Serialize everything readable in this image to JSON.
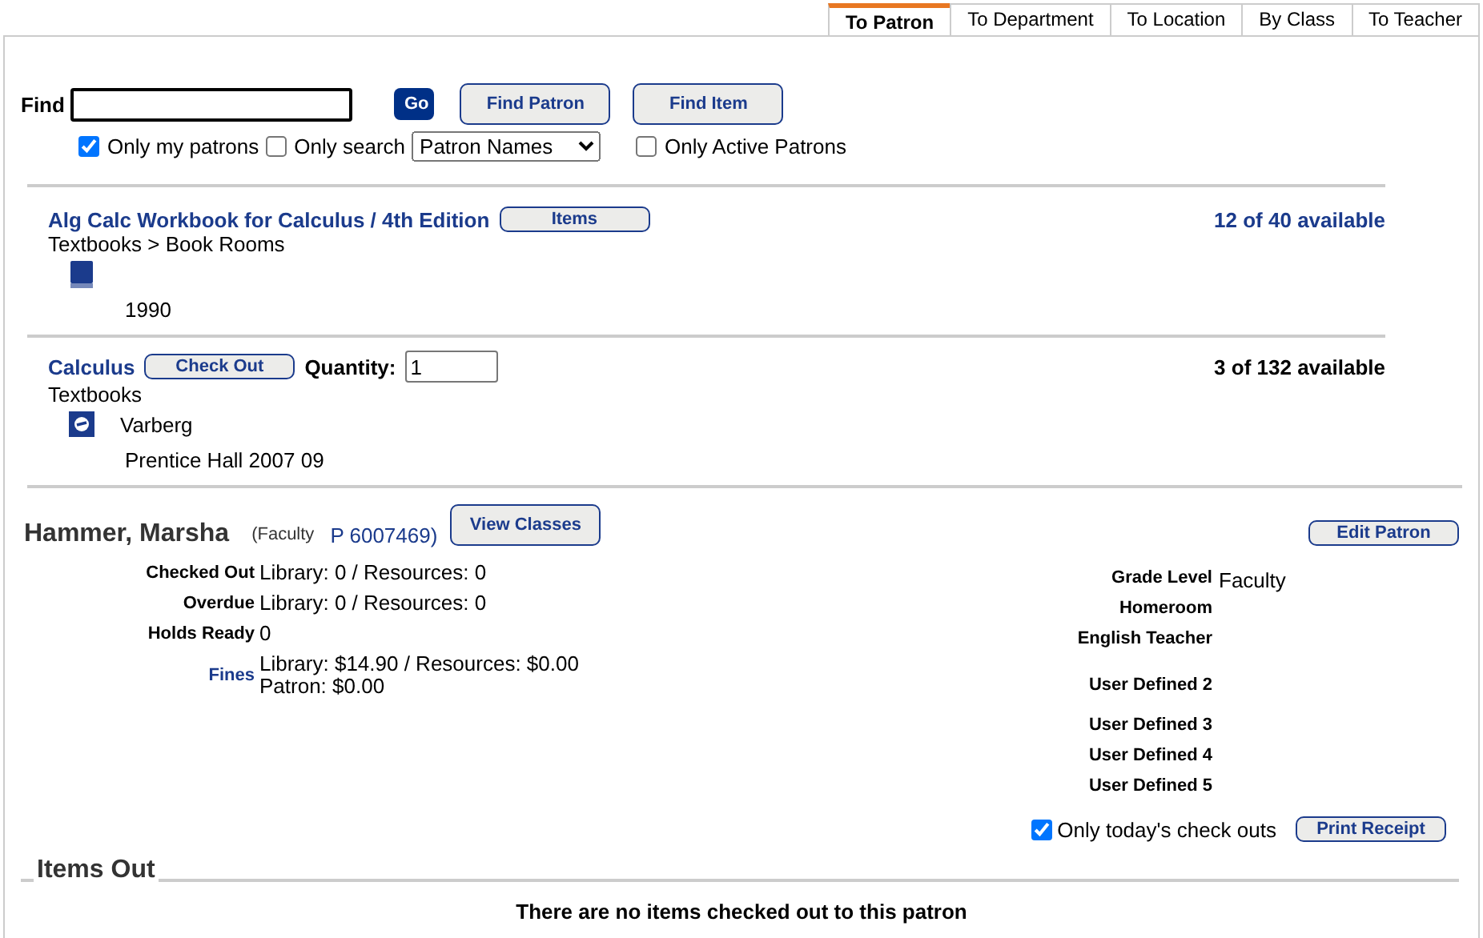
{
  "tabs": [
    {
      "label": "To Patron",
      "selected": true
    },
    {
      "label": "To Department",
      "selected": false
    },
    {
      "label": "To Location",
      "selected": false
    },
    {
      "label": "By Class",
      "selected": false
    },
    {
      "label": "To Teacher",
      "selected": false
    }
  ],
  "find": {
    "label": "Find",
    "go": "Go",
    "buttons": [
      "Find Patron",
      "Find Item"
    ]
  },
  "options": {
    "only_my_patrons": {
      "label": "Only my patrons",
      "checked": true
    },
    "only_search": {
      "label": "Only search",
      "checked": false
    },
    "search_select": "Patron Names",
    "only_active": {
      "label": "Only Active Patrons",
      "checked": false
    }
  },
  "items": [
    {
      "kind": "print",
      "title": "Alg Calc Workbook for Calculus / 4th Edition",
      "button": "Items",
      "availability": "12 of 40 available",
      "path": "Textbooks > Book Rooms",
      "details": "1990"
    },
    {
      "kind": "digital",
      "title": "Calculus",
      "button": "Check Out",
      "quantity_label": "Quantity:",
      "quantity": "1",
      "availability": "3 of 132 available",
      "path": "Textbooks",
      "author": "Varberg",
      "details": "Prentice Hall  2007  09"
    }
  ],
  "patron": {
    "name": "Hammer, Marsha",
    "type": "(Faculty",
    "id": "P 6007469)",
    "view_button": "View Classes",
    "edit_button": "Edit Patron",
    "stats": [
      {
        "label": "Checked Out",
        "kind": "text",
        "lines": [
          "Library: 0 / Resources: 0"
        ]
      },
      {
        "label": "Overdue",
        "kind": "text",
        "lines": [
          "Library: 0 / Resources: 0"
        ]
      },
      {
        "label": "Holds Ready",
        "kind": "text",
        "lines": [
          "0"
        ]
      },
      {
        "label": "Fines",
        "kind": "link",
        "lines": [
          "Library: $14.90 / Resources: $0.00",
          "Patron: $0.00"
        ]
      }
    ],
    "fields": [
      {
        "label": "Grade Level",
        "value": "Faculty"
      },
      {
        "label": "Homeroom"
      },
      {
        "label": "English Teacher"
      },
      {
        "label": "User Defined 2"
      },
      {
        "label": "User Defined 3"
      },
      {
        "label": "User Defined 4"
      },
      {
        "label": "User Defined 5"
      }
    ],
    "today_only": {
      "label": "Only today's check outs",
      "checked": true
    },
    "print_button": "Print Receipt"
  },
  "items_out": {
    "title": "Items Out",
    "message": "There are no items checked out to this patron"
  }
}
